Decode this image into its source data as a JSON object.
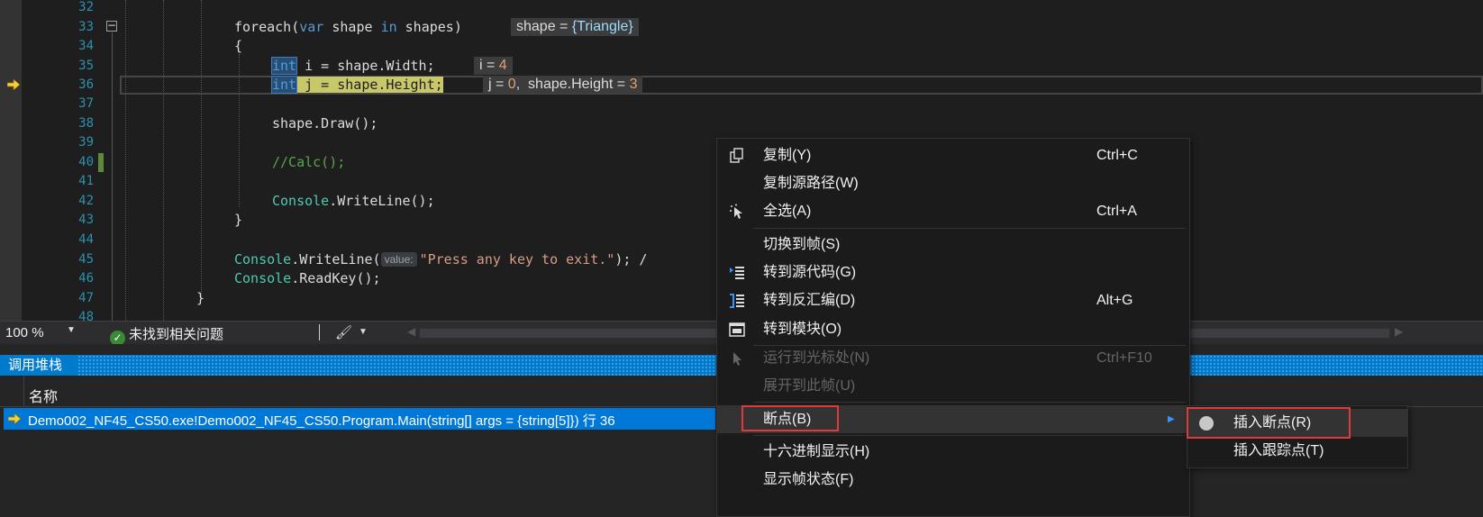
{
  "editor": {
    "lines": [
      {
        "num": "32",
        "html_key": "l32"
      },
      {
        "num": "33"
      },
      {
        "num": "34"
      },
      {
        "num": "35"
      },
      {
        "num": "36"
      },
      {
        "num": "37"
      },
      {
        "num": "38"
      },
      {
        "num": "39"
      },
      {
        "num": "40"
      },
      {
        "num": "41"
      },
      {
        "num": "42"
      },
      {
        "num": "43"
      },
      {
        "num": "44"
      },
      {
        "num": "45"
      },
      {
        "num": "46"
      },
      {
        "num": "47"
      },
      {
        "num": "48"
      }
    ],
    "code": {
      "l33_foreach": "foreach(",
      "l33_var": "var",
      "l33_shape": " shape ",
      "l33_in": "in",
      "l33_rest": " shapes)",
      "l34": "{",
      "l35_int": "int",
      "l35_rest": " i = shape.Width;",
      "l36_int": "int",
      "l36_rest": " j = shape.Height;",
      "l38": "shape.Draw();",
      "l40": "//Calc();",
      "l42_cls": "Console",
      "l42_rest": ".WriteLine();",
      "l43": "}",
      "l45_cls": "Console",
      "l45_mid": ".WriteLine(",
      "l45_hint": "value:",
      "l45_str": "\"Press any key to exit.\"",
      "l45_end": "); /",
      "l46_cls": "Console",
      "l46_rest": ".ReadKey();",
      "l47": "}"
    },
    "datatips": {
      "shape_name": "shape = ",
      "shape_val": "{Triangle}",
      "i_name": "i = ",
      "i_val": "4",
      "j_name": "j = ",
      "j_val": "0",
      "j_sep": ",  ",
      "h_name": "shape.Height = ",
      "h_val": "3"
    },
    "collapse_glyph": "−"
  },
  "status": {
    "zoom": "100 %",
    "issues_icon": "check-icon",
    "issues_text": "未找到相关问题"
  },
  "callstack": {
    "title": "调用堆栈",
    "column_name": "名称",
    "rows": [
      {
        "text": "Demo002_NF45_CS50.exe!Demo002_NF45_CS50.Program.Main(string[] args = {string[5]}) 行 36"
      }
    ]
  },
  "context_menu": {
    "items": [
      {
        "label": "复制(Y)",
        "shortcut": "Ctrl+C",
        "icon": "copy-icon",
        "enabled": true
      },
      {
        "label": "复制源路径(W)",
        "shortcut": "",
        "enabled": true
      },
      {
        "label": "全选(A)",
        "shortcut": "Ctrl+A",
        "icon": "select-all-icon",
        "enabled": true
      },
      {
        "label": "切换到帧(S)",
        "shortcut": "",
        "enabled": true
      },
      {
        "label": "转到源代码(G)",
        "shortcut": "",
        "icon": "go-to-source-icon",
        "enabled": true
      },
      {
        "label": "转到反汇编(D)",
        "shortcut": "Alt+G",
        "icon": "disassembly-icon",
        "enabled": true
      },
      {
        "label": "转到模块(O)",
        "shortcut": "",
        "icon": "module-icon",
        "enabled": true
      },
      {
        "label": "运行到光标处(N)",
        "shortcut": "Ctrl+F10",
        "icon": "run-to-cursor-icon",
        "enabled": false
      },
      {
        "label": "展开到此帧(U)",
        "shortcut": "",
        "enabled": false
      },
      {
        "label": "断点(B)",
        "shortcut": "",
        "enabled": true,
        "submenu": true
      },
      {
        "label": "十六进制显示(H)",
        "shortcut": "",
        "enabled": true
      },
      {
        "label": "显示帧状态(F)",
        "shortcut": "",
        "enabled": true
      }
    ]
  },
  "submenu": {
    "items": [
      {
        "label": "插入断点(R)",
        "icon": "breakpoint-icon"
      },
      {
        "label": "插入跟踪点(T)"
      }
    ]
  },
  "colors": {
    "accent": "#007acc",
    "selection": "#0078d7",
    "annotation_box": "#e03a3a",
    "current_line_highlight": "#c8c86a"
  }
}
